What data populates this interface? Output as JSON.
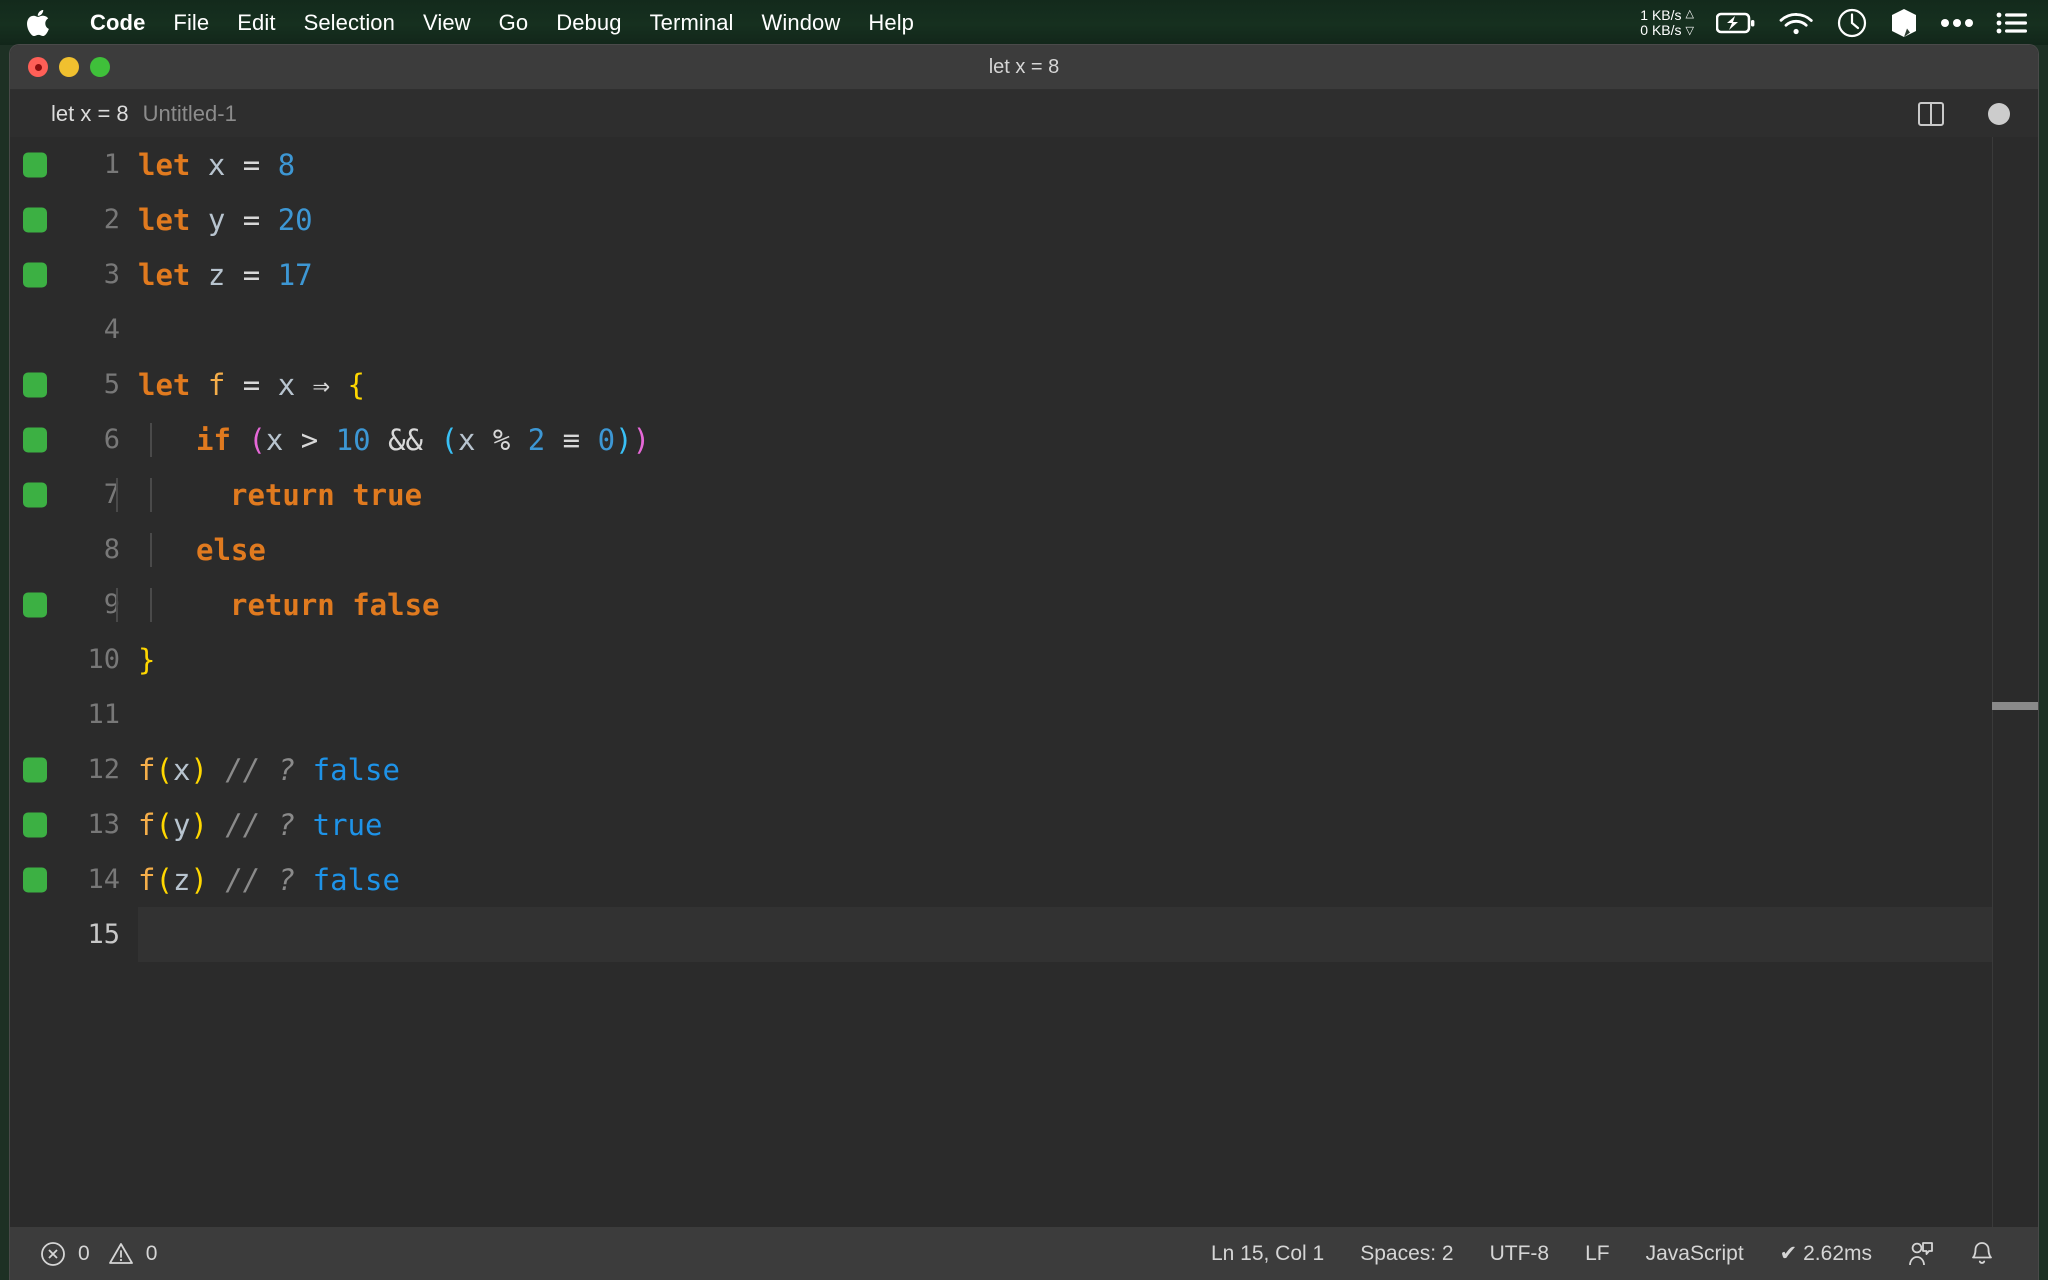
{
  "menubar": {
    "apple_icon": "apple-logo-icon",
    "items": [
      {
        "label": "Code",
        "bold": true
      },
      {
        "label": "File",
        "bold": false
      },
      {
        "label": "Edit",
        "bold": false
      },
      {
        "label": "Selection",
        "bold": false
      },
      {
        "label": "View",
        "bold": false
      },
      {
        "label": "Go",
        "bold": false
      },
      {
        "label": "Debug",
        "bold": false
      },
      {
        "label": "Terminal",
        "bold": false
      },
      {
        "label": "Window",
        "bold": false
      },
      {
        "label": "Help",
        "bold": false
      }
    ],
    "status": {
      "network_up": "1 KB/s",
      "network_down": "0 KB/s",
      "up_arrow": "△",
      "down_arrow": "▽",
      "icons": [
        "battery-charging-icon",
        "wifi-icon",
        "clock-icon",
        "box-icon",
        "ellipsis-icon",
        "list-menu-icon"
      ]
    }
  },
  "window": {
    "title": "let x = 8",
    "traffic_lights": [
      "close-button",
      "minimize-button",
      "maximize-button"
    ]
  },
  "breadcrumbs": {
    "active": "let x = 8",
    "file": "Untitled-1",
    "actions": [
      "split-editor-icon",
      "unsaved-dot-icon"
    ]
  },
  "editor": {
    "lines": [
      {
        "n": "1",
        "marker": true,
        "current": false,
        "indents": 0
      },
      {
        "n": "2",
        "marker": true,
        "current": false,
        "indents": 0
      },
      {
        "n": "3",
        "marker": true,
        "current": false,
        "indents": 0
      },
      {
        "n": "4",
        "marker": false,
        "current": false,
        "indents": 0
      },
      {
        "n": "5",
        "marker": true,
        "current": false,
        "indents": 0
      },
      {
        "n": "6",
        "marker": true,
        "current": false,
        "indents": 1
      },
      {
        "n": "7",
        "marker": true,
        "current": false,
        "indents": 2
      },
      {
        "n": "8",
        "marker": false,
        "current": false,
        "indents": 1
      },
      {
        "n": "9",
        "marker": true,
        "current": false,
        "indents": 2
      },
      {
        "n": "10",
        "marker": false,
        "current": false,
        "indents": 0
      },
      {
        "n": "11",
        "marker": false,
        "current": false,
        "indents": 0
      },
      {
        "n": "12",
        "marker": true,
        "current": false,
        "indents": 0
      },
      {
        "n": "13",
        "marker": true,
        "current": false,
        "indents": 0
      },
      {
        "n": "14",
        "marker": true,
        "current": false,
        "indents": 0
      },
      {
        "n": "15",
        "marker": false,
        "current": true,
        "indents": 0
      }
    ],
    "code": {
      "l1": {
        "kw": "let",
        "var": " x ",
        "op": "= ",
        "num": "8"
      },
      "l2": {
        "kw": "let",
        "var": " y ",
        "op": "= ",
        "num": "20"
      },
      "l3": {
        "kw": "let",
        "var": " z ",
        "op": "= ",
        "num": "17"
      },
      "l4": {
        "text": ""
      },
      "l5": {
        "kw": "let",
        "fn": " f ",
        "op1": "= ",
        "var": "x ",
        "arrow": "⇒",
        "brace": " {"
      },
      "l6": {
        "kw": "if ",
        "p1": "(",
        "v1": "x ",
        "gt": "> ",
        "n1": "10",
        "and": " && ",
        "p2": "(",
        "v2": "x ",
        "mod": "% ",
        "n2": "2 ",
        "eq": "≡",
        "n3": " 0",
        "p2c": ")",
        "p1c": ")"
      },
      "l7": {
        "kw": "return true"
      },
      "l8": {
        "kw": "else"
      },
      "l9": {
        "kw": "return false"
      },
      "l10": {
        "brace": "}"
      },
      "l11": {
        "text": ""
      },
      "l12": {
        "fn": "f",
        "po": "(",
        "arg": "x",
        "pc": ")",
        "cmt": " // ? ",
        "res": "false"
      },
      "l13": {
        "fn": "f",
        "po": "(",
        "arg": "y",
        "pc": ")",
        "cmt": " // ? ",
        "res": "true"
      },
      "l14": {
        "fn": "f",
        "po": "(",
        "arg": "z",
        "pc": ")",
        "cmt": " // ? ",
        "res": "false"
      },
      "l15": {
        "text": ""
      }
    }
  },
  "statusbar": {
    "error_icon": "error-circle-icon",
    "error_count": "0",
    "warning_icon": "warning-triangle-icon",
    "warning_count": "0",
    "cursor_position": "Ln 15, Col 1",
    "indentation": "Spaces: 2",
    "encoding": "UTF-8",
    "eol": "LF",
    "language": "JavaScript",
    "run_check": "✔",
    "run_time": "2.62ms",
    "live_share_icon": "live-share-icon",
    "bell_icon": "bell-icon"
  },
  "colors": {
    "menubar_bg": "#16301f",
    "window_chrome": "#3c3c3c",
    "editor_bg": "#2b2b2b",
    "keyword": "#e07a1f",
    "number": "#3d97d4",
    "result": "#1e93e8",
    "marker_green": "#3cb043",
    "bracket_yellow": "#ffd700",
    "bracket_magenta": "#e668d8",
    "bracket_cyan": "#39c0f5"
  }
}
